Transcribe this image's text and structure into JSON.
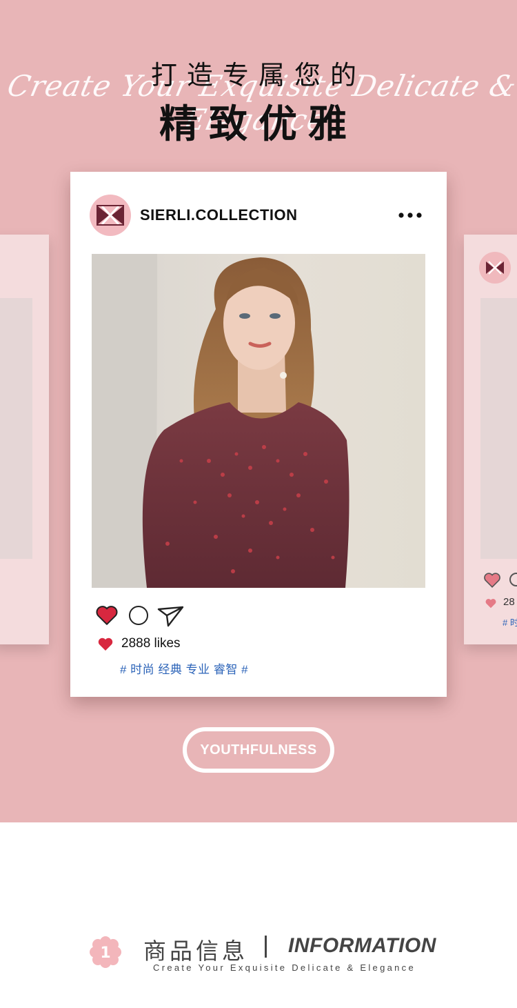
{
  "banner": {
    "script_text": "Create Your Exquisite Delicate & Elegance",
    "headline_top": "打造专属您的",
    "headline_main": "精致优雅"
  },
  "post": {
    "account_name": "SIERLI.COLLECTION",
    "more_icon": "more-horizontal-icon",
    "photo_subject": "model-in-burgundy-sequin-lace-dress",
    "likes_label": "2888 likes",
    "tags_label": "# 时尚 经典 专业 睿智 #"
  },
  "side_card_right": {
    "likes_label": "28",
    "tags_label": "# 时"
  },
  "button": {
    "label": "YOUTHFULNESS"
  },
  "info": {
    "number": "1",
    "title_cn": "商品信息",
    "title_en": "INFORMATION",
    "subtitle": "Create Your Exquisite Delicate & Elegance"
  },
  "colors": {
    "pink_bg": "#e8b5b7",
    "heart_red": "#d8283f",
    "tag_blue": "#2b63b8",
    "flower_pink": "#f3b6bb"
  }
}
